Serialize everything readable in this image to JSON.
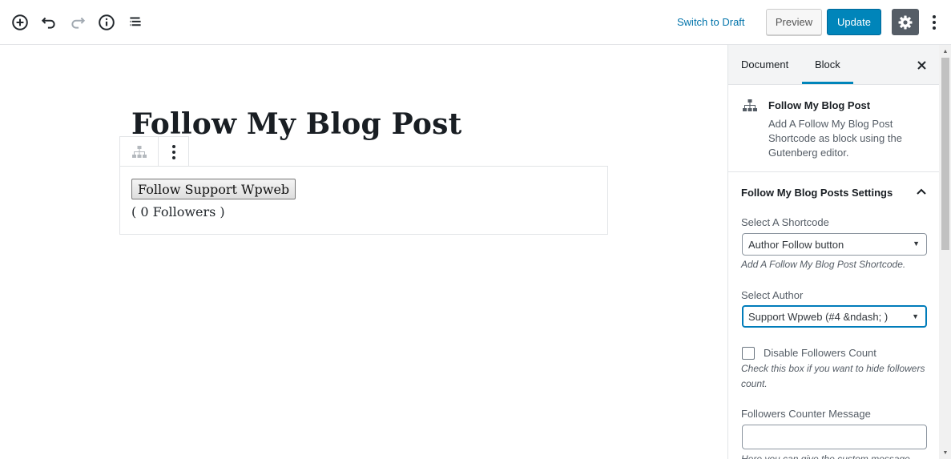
{
  "toolbar": {
    "icons": [
      "add-block-icon",
      "undo-icon",
      "redo-icon",
      "info-icon",
      "block-navigation-icon"
    ],
    "switch_to_draft": "Switch to Draft",
    "preview": "Preview",
    "update": "Update"
  },
  "editor": {
    "post_title": "Follow My Blog Post",
    "follow_button": "Follow Support Wpweb",
    "followers_text": "( 0 Followers )"
  },
  "sidebar": {
    "tabs": [
      {
        "label": "Document",
        "active": false
      },
      {
        "label": "Block",
        "active": true
      }
    ],
    "block_card": {
      "title": "Follow My Blog Post",
      "description": "Add A Follow My Blog Post Shortcode as block using the Gutenberg editor."
    },
    "panel": {
      "title": "Follow My Blog Posts Settings",
      "shortcode_label": "Select A Shortcode",
      "shortcode_value": "Author Follow button",
      "shortcode_help": "Add A Follow My Blog Post Shortcode.",
      "author_label": "Select Author",
      "author_value": "Support Wpweb (#4 &ndash; )",
      "disable_count_label": "Disable Followers Count",
      "disable_count_help": "Check this box if you want to hide followers count.",
      "counter_message_label": "Followers Counter Message",
      "counter_message_value": "",
      "counter_message_help": "Here you can give the custom message"
    }
  },
  "colors": {
    "accent": "#0085ba",
    "link": "#0073aa",
    "settings_active": "#555d66"
  }
}
